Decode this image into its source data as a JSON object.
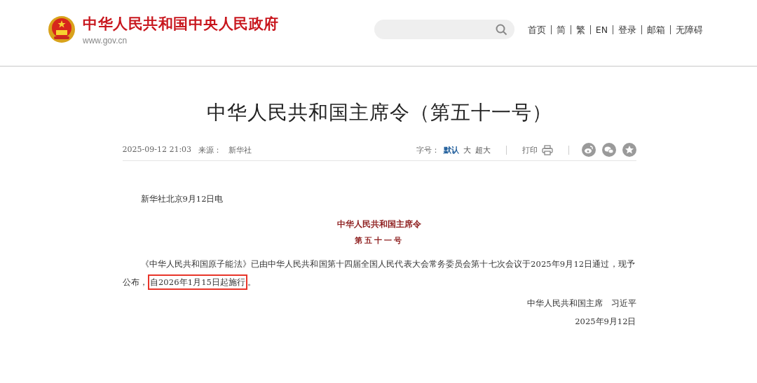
{
  "header": {
    "site_name": "中华人民共和国中央人民政府",
    "site_url": "www.gov.cn",
    "nav": [
      "首页",
      "简",
      "繁",
      "EN",
      "登录",
      "邮箱",
      "无障碍"
    ]
  },
  "article": {
    "title": "中华人民共和国主席令（第五十一号）",
    "meta": {
      "datetime": "2025-09-12 21:03",
      "source_label": "来源：",
      "source": "新华社",
      "font_label": "字号：",
      "font_sizes": [
        {
          "label": "默认",
          "selected": true
        },
        {
          "label": "大",
          "selected": false
        },
        {
          "label": "超大",
          "selected": false
        }
      ],
      "print": "打印"
    },
    "dateline": "新华社北京9月12日电",
    "order_title": "中华人民共和国主席令",
    "order_number": "第五十一号",
    "body": {
      "before": "《中华人民共和国原子能法》已由中华人民共和国第十四届全国人民代表大会常务委员会第十七次会议于2025年9月12日通过，现予公布，",
      "highlight": "自2026年1月15日起施行",
      "after": "。"
    },
    "signature": "中华人民共和国主席　习近平",
    "date": "2025年9月12日"
  }
}
